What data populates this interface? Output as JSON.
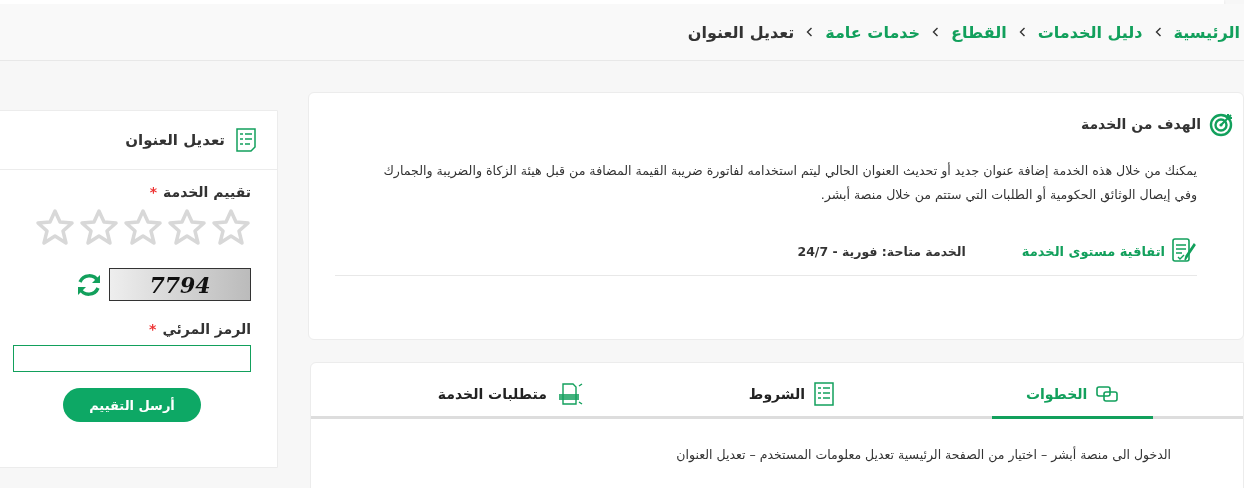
{
  "breadcrumb": [
    {
      "label": "الرئيسية",
      "current": false
    },
    {
      "label": "دليل الخدمات",
      "current": false
    },
    {
      "label": "القطاع",
      "current": false
    },
    {
      "label": "خدمات عامة",
      "current": false
    },
    {
      "label": "تعديل العنوان",
      "current": true
    }
  ],
  "goal": {
    "title": "الهدف من الخدمة",
    "text": "يمكنك من خلال هذه الخدمة إضافة عنوان جديد أو تحديث العنوان الحالي ليتم استخدامه لفاتورة ضريبة القيمة المضافة من قبل هيئة الزكاة والضريبة والجمارك وفي إيصال الوثائق الحكومية أو الطلبات التي ستتم من خلال منصة أبشر.",
    "sla_link": "اتفاقية مستوى الخدمة",
    "availability": "الخدمة متاحة: فورية - 24/7"
  },
  "tabs": [
    {
      "label": "الخطوات",
      "selected": true
    },
    {
      "label": "الشروط",
      "selected": false
    },
    {
      "label": "متطلبات الخدمة",
      "selected": false
    }
  ],
  "steps_text": "الدخول الى منصة أبشر – اختيار من الصفحة الرئيسية تعديل معلومات المستخدم – تعديل العنوان",
  "rating_panel": {
    "title": "تعديل العنوان",
    "rating_label": "تقييم الخدمة",
    "required_mark": "*",
    "stars": 0,
    "captcha": "7794",
    "code_label": "الرمز المرئي",
    "submit": "أرسل التقييم"
  }
}
